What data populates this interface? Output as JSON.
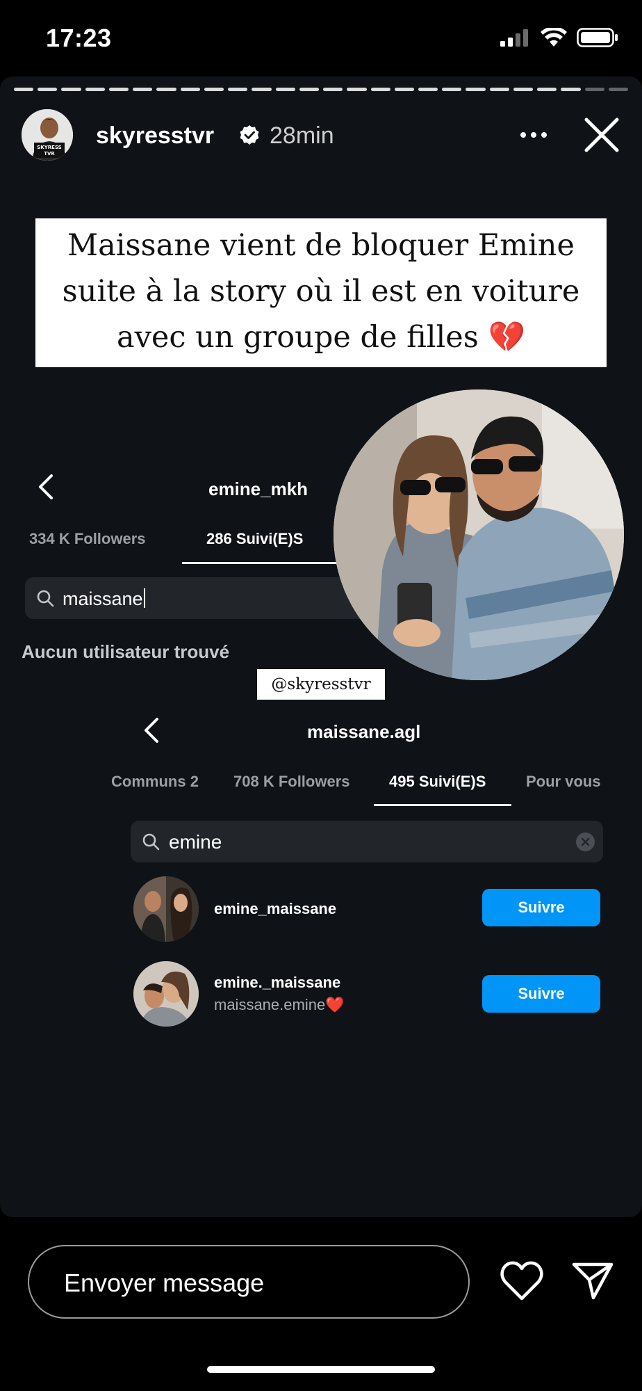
{
  "status_bar": {
    "time": "17:23"
  },
  "story": {
    "progress_segments_total": 26,
    "progress_segments_seen": 24,
    "username": "skyresstvr",
    "time_ago": "28min",
    "avatar_text": "SKYRESS TVR",
    "headline_lines": [
      "Maissane vient de bloquer Emine",
      "suite à la story où il est en voiture",
      "avec un groupe de filles 💔"
    ],
    "watermark": "@skyresstvr"
  },
  "panel1": {
    "profile_name": "emine_mkh",
    "tabs": [
      {
        "label": "334 K Followers"
      },
      {
        "label": "286 Suivi(E)S"
      }
    ],
    "search_value": "maissane",
    "empty_message": "Aucun utilisateur trouvé"
  },
  "panel2": {
    "profile_name": "maissane.agl",
    "tabs": [
      {
        "label": "2 Communs"
      },
      {
        "label": "708 K Followers"
      },
      {
        "label": "495 Suivi(E)S"
      },
      {
        "label": "Pour vous"
      }
    ],
    "search_value": "emine",
    "results": [
      {
        "username": "emine_maissane",
        "subtitle": "",
        "button": "Suivre"
      },
      {
        "username": "emine._maissane",
        "subtitle": "maissane.emine❤️",
        "button": "Suivre"
      }
    ]
  },
  "bottom_bar": {
    "message_placeholder": "Envoyer message"
  },
  "colors": {
    "follow_button": "#0095f6",
    "story_background": "#0f1216"
  }
}
